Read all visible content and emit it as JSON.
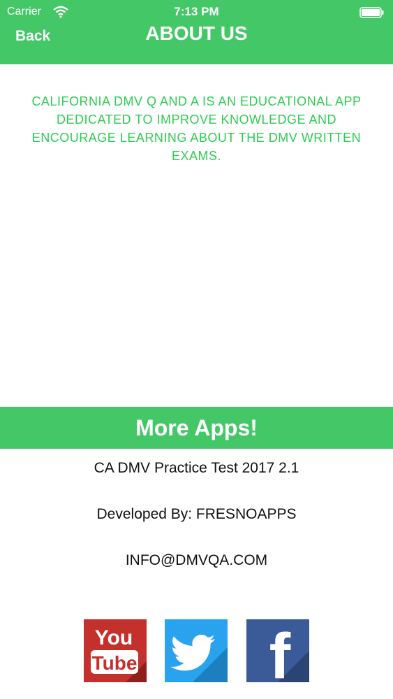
{
  "status_bar": {
    "carrier": "Carrier",
    "time": "7:13 PM"
  },
  "nav": {
    "back_label": "Back",
    "title": "ABOUT US"
  },
  "about": {
    "text": "CALIFORNIA DMV Q AND A IS AN EDUCATIONAL APP DEDICATED TO IMPROVE KNOWLEDGE AND ENCOURAGE LEARNING ABOUT THE DMV WRITTEN EXAMS."
  },
  "more_apps": {
    "label": "More Apps!"
  },
  "app_info": {
    "name_version": "CA DMV Practice Test 2017 2.1",
    "developer": "Developed By: FRESNOAPPS",
    "email": "INFO@DMVQA.COM"
  },
  "social": {
    "youtube": {
      "line1": "You",
      "line2": "Tube"
    },
    "twitter": {
      "icon": "twitter-bird-icon"
    },
    "facebook": {
      "letter": "f"
    }
  },
  "colors": {
    "brand_green": "#44c767",
    "text_green": "#2ecc52",
    "youtube_red": "#c4302b",
    "twitter_blue": "#2aa3ef",
    "facebook_blue": "#3b5a98"
  }
}
